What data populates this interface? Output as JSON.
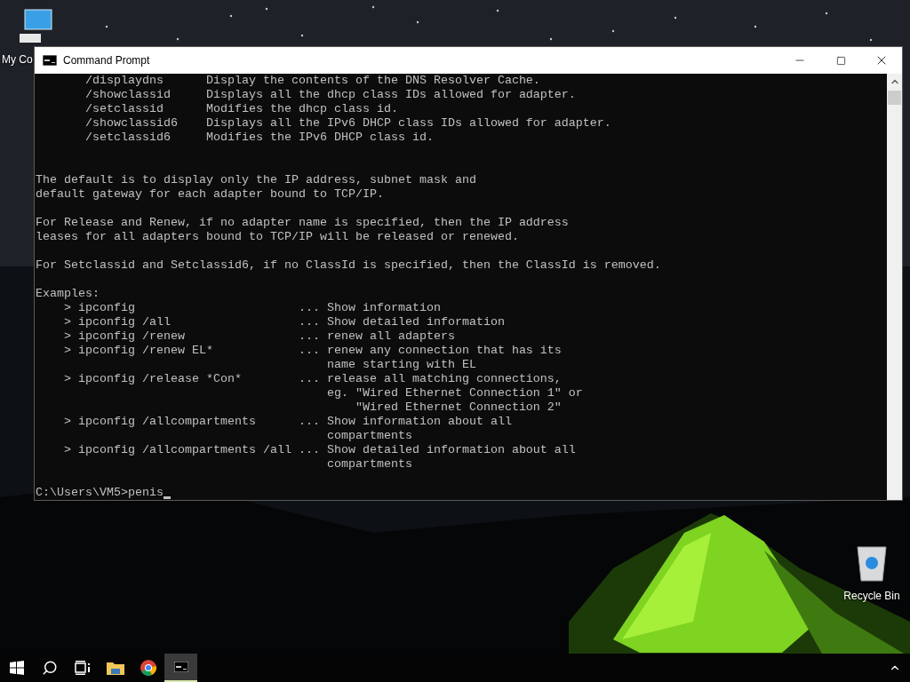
{
  "desktop": {
    "icons": [
      {
        "label": "My Co",
        "kind": "computer"
      },
      {
        "label": "Recycle Bin",
        "kind": "recycle"
      }
    ]
  },
  "window": {
    "title": "Command Prompt",
    "console": {
      "lines": [
        {
          "kind": "text",
          "text": "       /displaydns      Display the contents of the DNS Resolver Cache."
        },
        {
          "kind": "text",
          "text": "       /showclassid     Displays all the dhcp class IDs allowed for adapter."
        },
        {
          "kind": "text",
          "text": "       /setclassid      Modifies the dhcp class id."
        },
        {
          "kind": "text",
          "text": "       /showclassid6    Displays all the IPv6 DHCP class IDs allowed for adapter."
        },
        {
          "kind": "text",
          "text": "       /setclassid6     Modifies the IPv6 DHCP class id."
        },
        {
          "kind": "blank"
        },
        {
          "kind": "blank"
        },
        {
          "kind": "text",
          "text": "The default is to display only the IP address, subnet mask and"
        },
        {
          "kind": "text",
          "text": "default gateway for each adapter bound to TCP/IP."
        },
        {
          "kind": "blank"
        },
        {
          "kind": "text",
          "text": "For Release and Renew, if no adapter name is specified, then the IP address"
        },
        {
          "kind": "text",
          "text": "leases for all adapters bound to TCP/IP will be released or renewed."
        },
        {
          "kind": "blank"
        },
        {
          "kind": "text",
          "text": "For Setclassid and Setclassid6, if no ClassId is specified, then the ClassId is removed."
        },
        {
          "kind": "blank"
        },
        {
          "kind": "text",
          "text": "Examples:"
        },
        {
          "kind": "text",
          "text": "    > ipconfig                       ... Show information"
        },
        {
          "kind": "text",
          "text": "    > ipconfig /all                  ... Show detailed information"
        },
        {
          "kind": "text",
          "text": "    > ipconfig /renew                ... renew all adapters"
        },
        {
          "kind": "text",
          "text": "    > ipconfig /renew EL*            ... renew any connection that has its"
        },
        {
          "kind": "text",
          "text": "                                         name starting with EL"
        },
        {
          "kind": "text",
          "text": "    > ipconfig /release *Con*        ... release all matching connections,"
        },
        {
          "kind": "text",
          "text": "                                         eg. \"Wired Ethernet Connection 1\" or"
        },
        {
          "kind": "text",
          "text": "                                             \"Wired Ethernet Connection 2\""
        },
        {
          "kind": "text",
          "text": "    > ipconfig /allcompartments      ... Show information about all"
        },
        {
          "kind": "text",
          "text": "                                         compartments"
        },
        {
          "kind": "text",
          "text": "    > ipconfig /allcompartments /all ... Show detailed information about all"
        },
        {
          "kind": "text",
          "text": "                                         compartments"
        },
        {
          "kind": "blank"
        }
      ],
      "prompt": "C:\\Users\\VM5>",
      "input": "penis"
    }
  },
  "taskbar": {
    "items": [
      {
        "kind": "start",
        "selected": false
      },
      {
        "kind": "search",
        "selected": false
      },
      {
        "kind": "taskview",
        "selected": false
      },
      {
        "kind": "folder",
        "selected": false
      },
      {
        "kind": "browser",
        "selected": false
      },
      {
        "kind": "terminal",
        "selected": true
      }
    ]
  }
}
